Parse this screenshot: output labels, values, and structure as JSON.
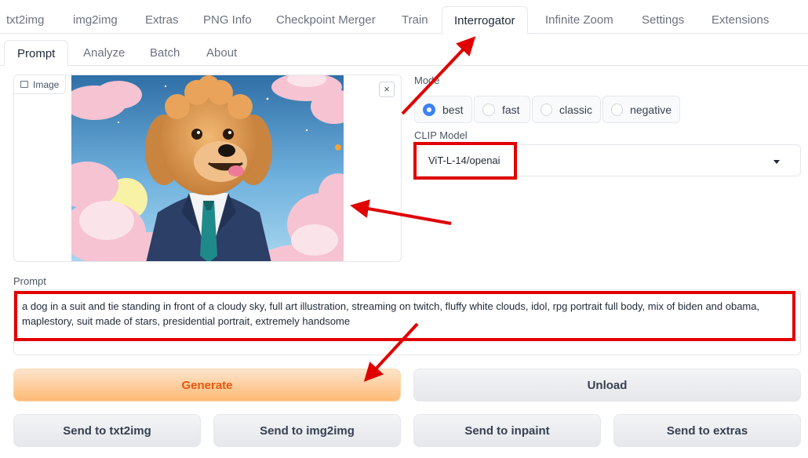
{
  "top_tabs": [
    "txt2img",
    "img2img",
    "Extras",
    "PNG Info",
    "Checkpoint Merger",
    "Train",
    "Interrogator",
    "Infinite Zoom",
    "Settings",
    "Extensions"
  ],
  "active_top_tab": "Interrogator",
  "sub_tabs": [
    "Prompt",
    "Analyze",
    "Batch",
    "About"
  ],
  "active_sub_tab": "Prompt",
  "image_panel": {
    "label": "Image",
    "clear_glyph": "×",
    "image_icon": "image-icon",
    "content": "dog-in-suit-illustration"
  },
  "mode": {
    "label": "Mode",
    "options": [
      "best",
      "fast",
      "classic",
      "negative"
    ],
    "selected": "best"
  },
  "clip_model": {
    "label": "CLIP Model",
    "value": "ViT-L-14/openai"
  },
  "prompt": {
    "label": "Prompt",
    "value": "a dog in a suit and tie standing in front of a cloudy sky, full art illustration, streaming on twitch, fluffy white clouds, idol, rpg portrait full body, mix of biden and obama, maplestory, suit made of stars, presidential portrait, extremely handsome"
  },
  "buttons": {
    "generate": "Generate",
    "unload": "Unload",
    "send_txt2img": "Send to txt2img",
    "send_img2img": "Send to img2img",
    "send_inpaint": "Send to inpaint",
    "send_extras": "Send to extras"
  },
  "colors": {
    "annotation": "#e10000",
    "accent": "#3b82f6",
    "primary_button_text": "#ea580c"
  }
}
